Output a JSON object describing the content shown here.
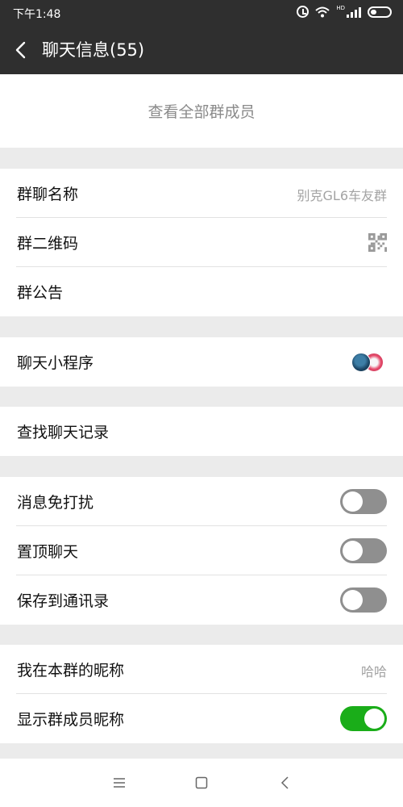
{
  "status_bar": {
    "time": "下午1:48",
    "network_badge": "HD",
    "icons": [
      "alarm-icon",
      "wifi-icon",
      "signal-icon",
      "battery-icon"
    ]
  },
  "header": {
    "title": "聊天信息(55)",
    "back_icon": "chevron-left-icon"
  },
  "members": {
    "view_all_label": "查看全部群成员"
  },
  "group_info": {
    "name_label": "群聊名称",
    "name_value": "别克GL6车友群",
    "qr_label": "群二维码",
    "announcement_label": "群公告"
  },
  "mini_programs": {
    "label": "聊天小程序"
  },
  "search": {
    "label": "查找聊天记录"
  },
  "settings": {
    "mute_label": "消息免打扰",
    "mute_on": false,
    "pin_label": "置顶聊天",
    "pin_on": false,
    "save_contacts_label": "保存到通讯录",
    "save_contacts_on": false
  },
  "nickname": {
    "my_nickname_label": "我在本群的昵称",
    "my_nickname_value": "哈哈",
    "show_nicknames_label": "显示群成员昵称",
    "show_nicknames_on": true
  },
  "colors": {
    "header_bg": "#2f2f2f",
    "toggle_on": "#1aad19",
    "toggle_off": "#8f8f8f",
    "page_bg": "#ebebeb"
  },
  "system_nav": {
    "icons": [
      "menu-icon",
      "home-icon",
      "back-icon"
    ]
  }
}
